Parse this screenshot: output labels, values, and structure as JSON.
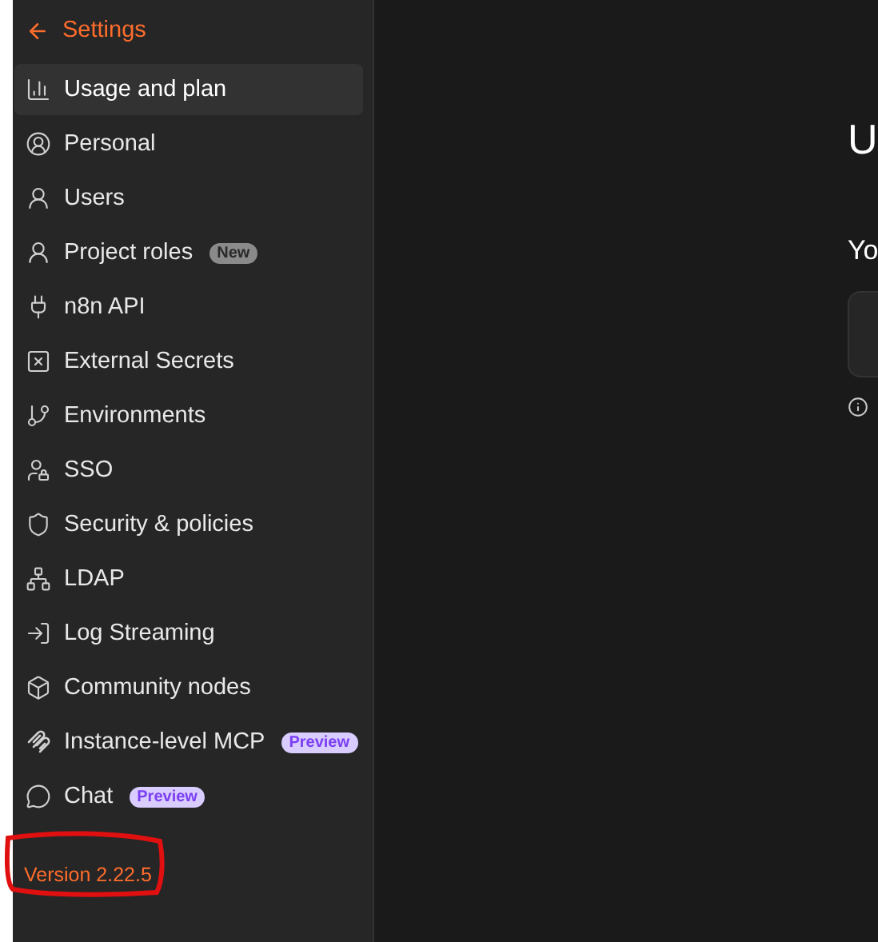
{
  "sidebar": {
    "back_label": "Settings",
    "items": [
      {
        "label": "Usage and plan",
        "selected": true
      },
      {
        "label": "Personal",
        "selected": false
      },
      {
        "label": "Users",
        "selected": false
      },
      {
        "label": "Project roles",
        "selected": false,
        "badge": {
          "label": "New",
          "kind": "neutral"
        }
      },
      {
        "label": "n8n API",
        "selected": false
      },
      {
        "label": "External Secrets",
        "selected": false
      },
      {
        "label": "Environments",
        "selected": false
      },
      {
        "label": "SSO",
        "selected": false
      },
      {
        "label": "Security & policies",
        "selected": false
      },
      {
        "label": "LDAP",
        "selected": false
      },
      {
        "label": "Log Streaming",
        "selected": false
      },
      {
        "label": "Community nodes",
        "selected": false
      },
      {
        "label": "Instance-level MCP",
        "selected": false,
        "badge": {
          "label": "Preview",
          "kind": "preview"
        }
      },
      {
        "label": "Chat",
        "selected": false,
        "badge": {
          "label": "Preview",
          "kind": "preview"
        }
      }
    ],
    "version": "Version 2.22.5"
  },
  "main": {
    "title": "U",
    "subtitle": "Yo"
  }
}
